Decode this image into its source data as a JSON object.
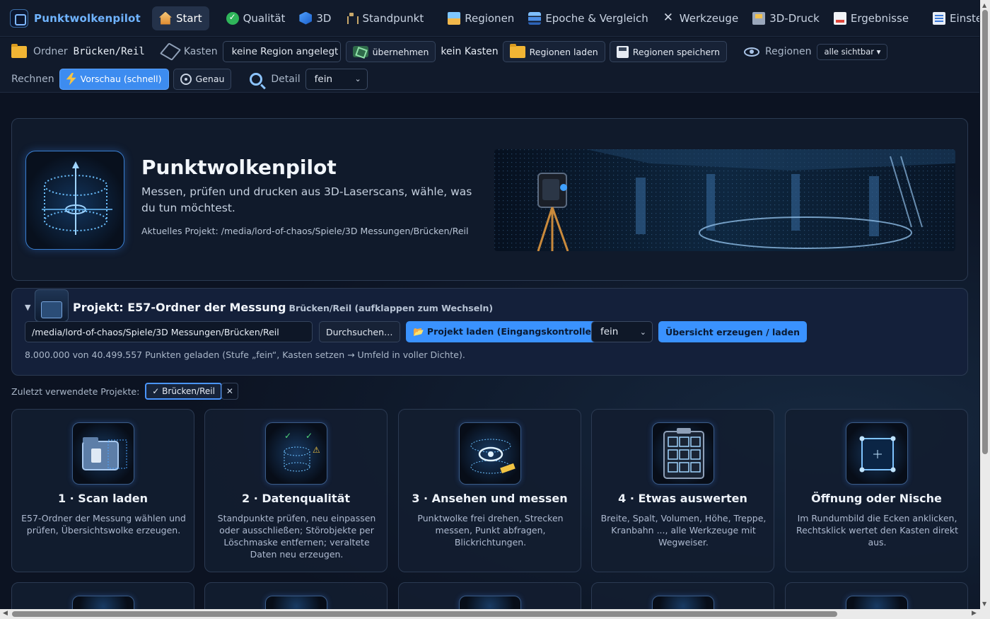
{
  "app": {
    "name": "Punktwolkenpilot"
  },
  "nav": {
    "items": [
      {
        "label": "Start",
        "icon": "home-icon",
        "active": true
      },
      {
        "label": "Qualität",
        "icon": "check-circle-icon"
      },
      {
        "label": "3D",
        "icon": "cube-icon"
      },
      {
        "label": "Standpunkt",
        "icon": "tripod-icon"
      },
      {
        "label": "Regionen",
        "icon": "regions-icon"
      },
      {
        "label": "Epoche & Vergleich",
        "icon": "layers-icon"
      },
      {
        "label": "Werkzeuge",
        "icon": "tools-icon"
      },
      {
        "label": "3D-Druck",
        "icon": "printer-icon"
      },
      {
        "label": "Ergebnisse",
        "icon": "document-icon"
      },
      {
        "label": "Einstellungen",
        "icon": "settings-icon"
      }
    ]
  },
  "toolbar": {
    "ordner_label": "Ordner",
    "ordner_value": "Brücken/Reil",
    "kasten_label": "Kasten",
    "region_select": "keine Region angelegt",
    "uebernehmen": "übernehmen",
    "kein_kasten": "kein Kasten",
    "regionen_laden": "Regionen laden",
    "regionen_speichern": "Regionen speichern",
    "regionen_label": "Regionen",
    "sichtbar_select": "alle sichtbar ▾",
    "rechnen_label": "Rechnen",
    "vorschau": "Vorschau (schnell)",
    "genau": "Genau",
    "detail_label": "Detail",
    "detail_select": "fein"
  },
  "hero": {
    "title": "Punktwolkenpilot",
    "subtitle": "Messen, prüfen und drucken aus 3D-Laserscans, wähle, was du tun möchtest.",
    "project_path": "Aktuelles Projekt: /media/lord-of-chaos/Spiele/3D Messungen/Brücken/Reil"
  },
  "project": {
    "title": "Projekt: E57-Ordner der Messung",
    "subtitle": "Brücken/Reil (aufklappen zum Wechseln)",
    "path_value": "/media/lord-of-chaos/Spiele/3D Messungen/Brücken/Reil",
    "browse": "Durchsuchen…",
    "load": "📂 Projekt laden (Eingangskontrolle)",
    "level_select": "fein",
    "overview": "Übersicht erzeugen / laden",
    "status": "8.000.000 von 40.499.557 Punkten geladen (Stufe „fein“, Kasten setzen → Umfeld in voller Dichte)."
  },
  "recent": {
    "label": "Zuletzt verwendete Projekte:",
    "chip": "✓ Brücken/Reil",
    "remove": "✕"
  },
  "cards": [
    {
      "title": "1 · Scan laden",
      "text": "E57-Ordner der Messung wählen und prüfen, Übersichtswolke erzeugen.",
      "icon": "folder-scan-icon"
    },
    {
      "title": "2 · Datenqualität",
      "text": "Standpunkte prüfen, neu einpassen oder ausschließen; Störobjekte per Löschmaske entfernen; veraltete Daten neu erzeugen.",
      "icon": "quality-icon"
    },
    {
      "title": "3 · Ansehen und messen",
      "text": "Punktwolke frei drehen, Strecken messen, Punkt abfragen, Blickrichtungen.",
      "icon": "eye-measure-icon"
    },
    {
      "title": "4 · Etwas auswerten",
      "text": "Breite, Spalt, Volumen, Höhe, Treppe, Kranbahn ..., alle Werkzeuge mit Wegweiser.",
      "icon": "tools-grid-icon"
    },
    {
      "title": "Öffnung oder Nische",
      "text": "Im Rundumbild die Ecken anklicken, Rechtsklick wertet den Kasten direkt aus.",
      "icon": "opening-icon"
    }
  ],
  "colors": {
    "accent": "#3a92ff",
    "brand": "#6fb3ff",
    "background": "#0c1322"
  }
}
